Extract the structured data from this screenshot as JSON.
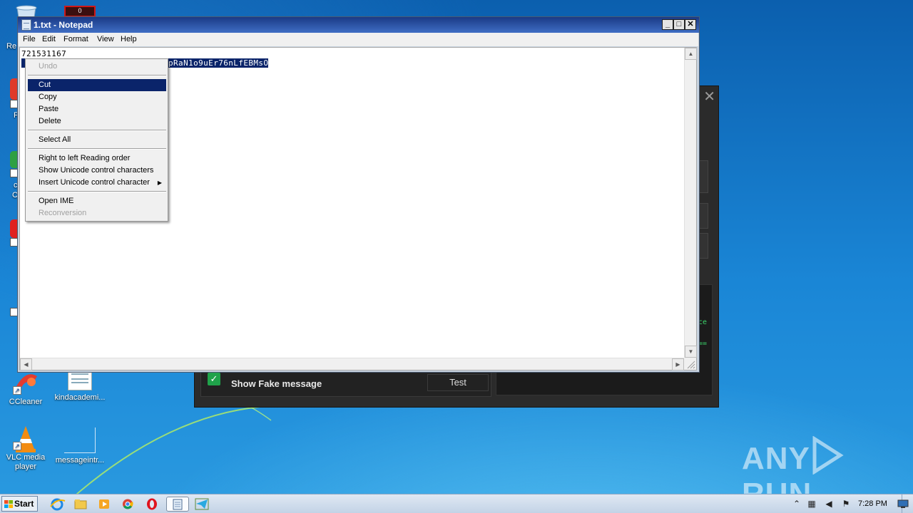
{
  "notepad": {
    "title": "1.txt - Notepad",
    "menus": [
      "File",
      "Edit",
      "Format",
      "View",
      "Help"
    ],
    "line1": "721531167",
    "line2_visible": "pRaN1o9uEr76nLfEBMsO",
    "caption": {
      "minimize": "_",
      "maximize": "□",
      "close": "✕"
    }
  },
  "context_menu": {
    "items": [
      {
        "label": "Undo",
        "enabled": false
      },
      {
        "label": "Cut",
        "enabled": true,
        "highlighted": true
      },
      {
        "label": "Copy",
        "enabled": true
      },
      {
        "label": "Paste",
        "enabled": true
      },
      {
        "label": "Delete",
        "enabled": true
      },
      {
        "label": "Select All",
        "enabled": true
      },
      {
        "label": "Right to left Reading order",
        "enabled": true
      },
      {
        "label": "Show Unicode control characters",
        "enabled": true
      },
      {
        "label": "Insert Unicode control character",
        "enabled": true,
        "submenu": true
      },
      {
        "label": "Open IME",
        "enabled": true
      },
      {
        "label": "Reconversion",
        "enabled": false
      }
    ]
  },
  "background_app": {
    "checkbox_label": "Show Fake message",
    "checkbox_checked": true,
    "test_button": "Test",
    "green_fragments": [
      "ce",
      "=="
    ]
  },
  "desktop": {
    "icons": [
      {
        "label": "CCleaner"
      },
      {
        "label": "kindacademi..."
      },
      {
        "label": "VLC media player"
      },
      {
        "label": "messageintr..."
      }
    ],
    "edge_fragments": [
      "Re",
      "F",
      "c",
      "C"
    ],
    "recycle_badge": "0"
  },
  "taskbar": {
    "start_label": "Start",
    "clock": "7:28 PM"
  },
  "watermark": {
    "left": "ANY",
    "right": "RUN"
  },
  "colors": {
    "selection": "#0a246a",
    "accent_green": "#1fa24a",
    "titlebar": "#1a3a86"
  }
}
